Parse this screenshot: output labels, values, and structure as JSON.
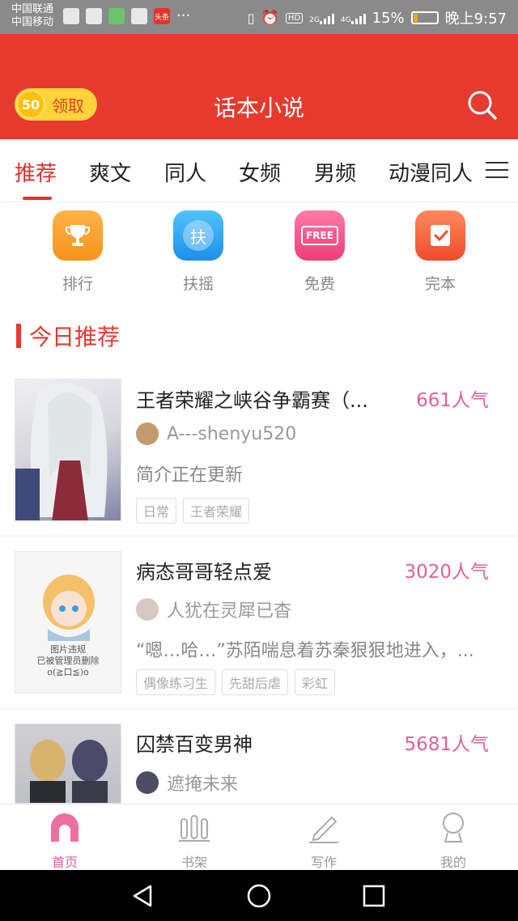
{
  "status_bar": {
    "carrier1": "中国联通",
    "carrier2": "中国移动",
    "news_badge": "头条",
    "dots": "···",
    "hd": "HD",
    "net2g": "2G",
    "net4g": "4G",
    "battery_pct": "15%",
    "time": "晚上9:57"
  },
  "header": {
    "coin_value": "50",
    "coin_label": "领取",
    "title": "话本小说"
  },
  "tabs": [
    "推荐",
    "爽文",
    "同人",
    "女频",
    "男频",
    "动漫同人"
  ],
  "active_tab_index": 0,
  "shortcuts": [
    {
      "label": "排行",
      "icon": "trophy-icon",
      "color": "#f7931e"
    },
    {
      "label": "扶摇",
      "icon": "fuyao-icon",
      "text": "扶",
      "color": "#2aa7f0"
    },
    {
      "label": "免费",
      "icon": "free-icon",
      "text": "FREE",
      "color": "#f2528a"
    },
    {
      "label": "完本",
      "icon": "check-book-icon",
      "color": "#f4603a"
    }
  ],
  "section": {
    "title": "今日推荐"
  },
  "books": [
    {
      "title": "王者荣耀之峡谷争霸赛（...",
      "popularity": "661人气",
      "author": "A---shenyu520",
      "desc": "简介正在更新",
      "tags": [
        "日常",
        "王者荣耀"
      ]
    },
    {
      "title": "病态哥哥轻点爱",
      "popularity": "3020人气",
      "author": "人犹在灵犀已杳",
      "desc": "“嗯…哈…”苏陌喘息着苏秦狠狠地进入，...",
      "tags": [
        "偶像练习生",
        "先甜后虐",
        "彩虹"
      ],
      "cover_text": [
        "图片违规",
        "已被管理员删除",
        "o(≧口≦)o"
      ]
    },
    {
      "title": "囚禁百变男神",
      "popularity": "5681人气",
      "author": "遮掩未来"
    }
  ],
  "bottom_nav": [
    {
      "label": "首页",
      "icon": "home-icon"
    },
    {
      "label": "书架",
      "icon": "bookshelf-icon"
    },
    {
      "label": "写作",
      "icon": "pen-icon"
    },
    {
      "label": "我的",
      "icon": "profile-icon"
    }
  ],
  "colors": {
    "brand_red": "#e63a2f",
    "pink": "#e0609a"
  }
}
